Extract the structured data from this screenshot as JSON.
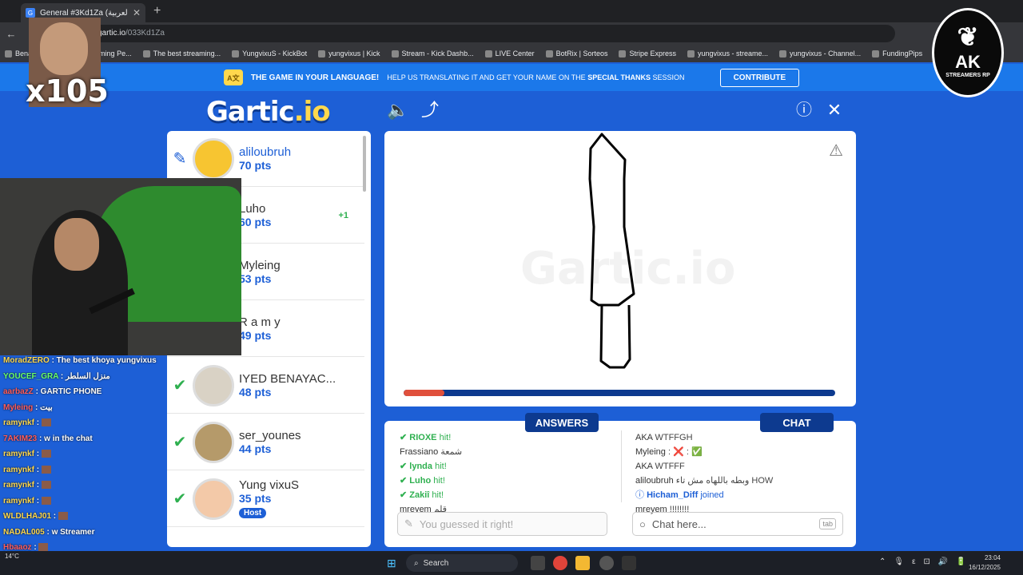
{
  "browser": {
    "tab_title": "General #3Kd1Za (العربية)",
    "tab_icon": "G",
    "url_host": "gartic.io",
    "url_path": "/033Kd1Za",
    "url_prefix": "",
    "bookmarks": [
      "Benai...",
      "Algerian Gaming Pe...",
      "The best streaming...",
      "YungvixuS - KickBot",
      "yungvixus | Kick",
      "Stream - Kick Dashb...",
      "LIVE Center",
      "BotRix | Sorteos",
      "Stripe Express",
      "yungvixus - streame...",
      "yungvixus - Channel...",
      "FundingPips"
    ]
  },
  "banner": {
    "title": "THE GAME IN YOUR LANGUAGE!",
    "text_pre": "HELP US TRANSLATING IT AND GET YOUR NAME ON THE",
    "text_bold": "SPECIAL THANKS",
    "text_post": "SESSION",
    "button": "CONTRIBUTE"
  },
  "logo": {
    "main": "Gartic",
    "suffix": ".io"
  },
  "players": [
    {
      "name": "aliloubruh",
      "pts": "70 pts",
      "status": "drawing",
      "avatar_color": "#f7c531"
    },
    {
      "name": "Luho",
      "pts": "60 pts",
      "status": "none",
      "delta": "+1",
      "avatar_color": "#9aa"
    },
    {
      "name": "Myleing",
      "pts": "53 pts",
      "status": "none",
      "avatar_color": "#c9b"
    },
    {
      "name": "R a m y",
      "pts": "49 pts",
      "status": "none",
      "avatar_color": "#abc"
    },
    {
      "name": "IYED BENAYAC...",
      "pts": "48 pts",
      "status": "guessed",
      "avatar_color": "#d9d2c5"
    },
    {
      "name": "ser_younes",
      "pts": "44 pts",
      "status": "guessed",
      "avatar_color": "#b59a6a"
    },
    {
      "name": "Yung vixuS",
      "pts": "35 pts",
      "status": "guessed",
      "host": "Host",
      "avatar_color": "#f3c9a8"
    }
  ],
  "canvas": {
    "watermark": "Gartic.io",
    "progress_fraction": 0.095
  },
  "answers": {
    "label": "ANSWERS",
    "lines": [
      {
        "user": "RIOXE",
        "text": "hit!",
        "hit": true
      },
      {
        "user": "Frassiano",
        "text": "شمعة",
        "hit": false
      },
      {
        "user": "lynda",
        "text": "hit!",
        "hit": true
      },
      {
        "user": "Luho",
        "text": "hit!",
        "hit": true
      },
      {
        "user": "Zakiî",
        "text": "hit!",
        "hit": true
      },
      {
        "user": "mreyem",
        "text": "قلم",
        "hit": false
      }
    ],
    "placeholder": "You guessed it right!"
  },
  "chat": {
    "label": "CHAT",
    "lines": [
      {
        "user": "AKA",
        "text": "WTFFGH"
      },
      {
        "user": "Myleing",
        "text": ": ❌ : ✅"
      },
      {
        "user": "AKA",
        "text": "WTFFF"
      },
      {
        "user": "aliloubruh",
        "text": "وبطه باللهاه مش تاء HOW"
      },
      {
        "user": "Hicham_Diff",
        "text": "joined",
        "system": true
      },
      {
        "user": "mreyem",
        "text": "!!!!!!!!"
      }
    ],
    "placeholder": "Chat here...",
    "tab_hint": "tab"
  },
  "overlay": {
    "emote_text": "x105",
    "chat": [
      {
        "user": "MoradZERO",
        "text": ": The best khoya yungvixus",
        "color": "y"
      },
      {
        "user": "YOUCEF_GRA",
        "text": ": منزل السلطر",
        "color": "g"
      },
      {
        "user": "aarbazZ",
        "text": ": GARTIC PHONE",
        "color": "r"
      },
      {
        "user": "Myleing",
        "text": ": بيت",
        "color": "r"
      },
      {
        "user": "ramynkf",
        "text": ":",
        "color": "y",
        "emote": true
      },
      {
        "user": "7AKIM23",
        "text": ": w in the chat",
        "color": "r"
      },
      {
        "user": "ramynkf",
        "text": ":",
        "color": "y",
        "emote": true
      },
      {
        "user": "ramynkf",
        "text": ":",
        "color": "y",
        "emote": true
      },
      {
        "user": "ramynkf",
        "text": ":",
        "color": "y",
        "emote": true
      },
      {
        "user": "ramynkf",
        "text": ":",
        "color": "y",
        "emote": true
      },
      {
        "user": "WLDLHAJ01",
        "text": ":",
        "color": "y",
        "emote": true
      },
      {
        "user": "NADAL005",
        "text": ": w Streamer",
        "color": "y"
      },
      {
        "user": "Hbaaoz",
        "text": ":",
        "color": "r",
        "emote": true
      }
    ],
    "ak_logo": {
      "main": "AK",
      "sub": "STREAMERS RP"
    }
  },
  "taskbar": {
    "search": "Search",
    "time": "23:04",
    "date": "16/12/2025",
    "weather": "14°C"
  }
}
